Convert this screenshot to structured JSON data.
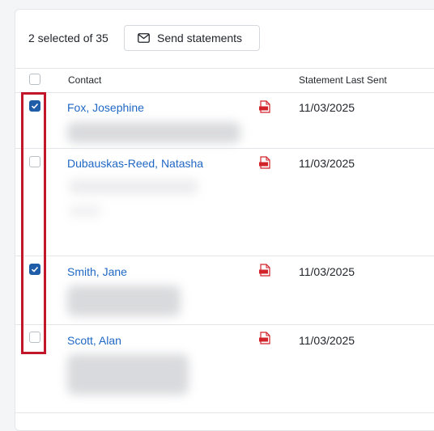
{
  "toolbar": {
    "selected_text": "2 selected of 35",
    "send_label": "Send statements",
    "send_icon": "envelope-icon"
  },
  "table": {
    "columns": [
      "Contact",
      "Statement Last Sent"
    ],
    "rows": [
      {
        "name": "Fox, Josephine",
        "date": "11/03/2025",
        "checked": true,
        "icon": "pdf-icon"
      },
      {
        "name": "Dubauskas-Reed, Natasha",
        "date": "11/03/2025",
        "checked": false,
        "icon": "pdf-icon"
      },
      {
        "name": "Smith, Jane",
        "date": "11/03/2025",
        "checked": true,
        "icon": "pdf-icon"
      },
      {
        "name": "Scott, Alan",
        "date": "11/03/2025",
        "checked": false,
        "icon": "pdf-icon"
      }
    ]
  },
  "colors": {
    "link": "#1f67c4",
    "checkbox_checked": "#1f5da8",
    "highlight": "#c2172a",
    "pdf": "#d2232a"
  }
}
